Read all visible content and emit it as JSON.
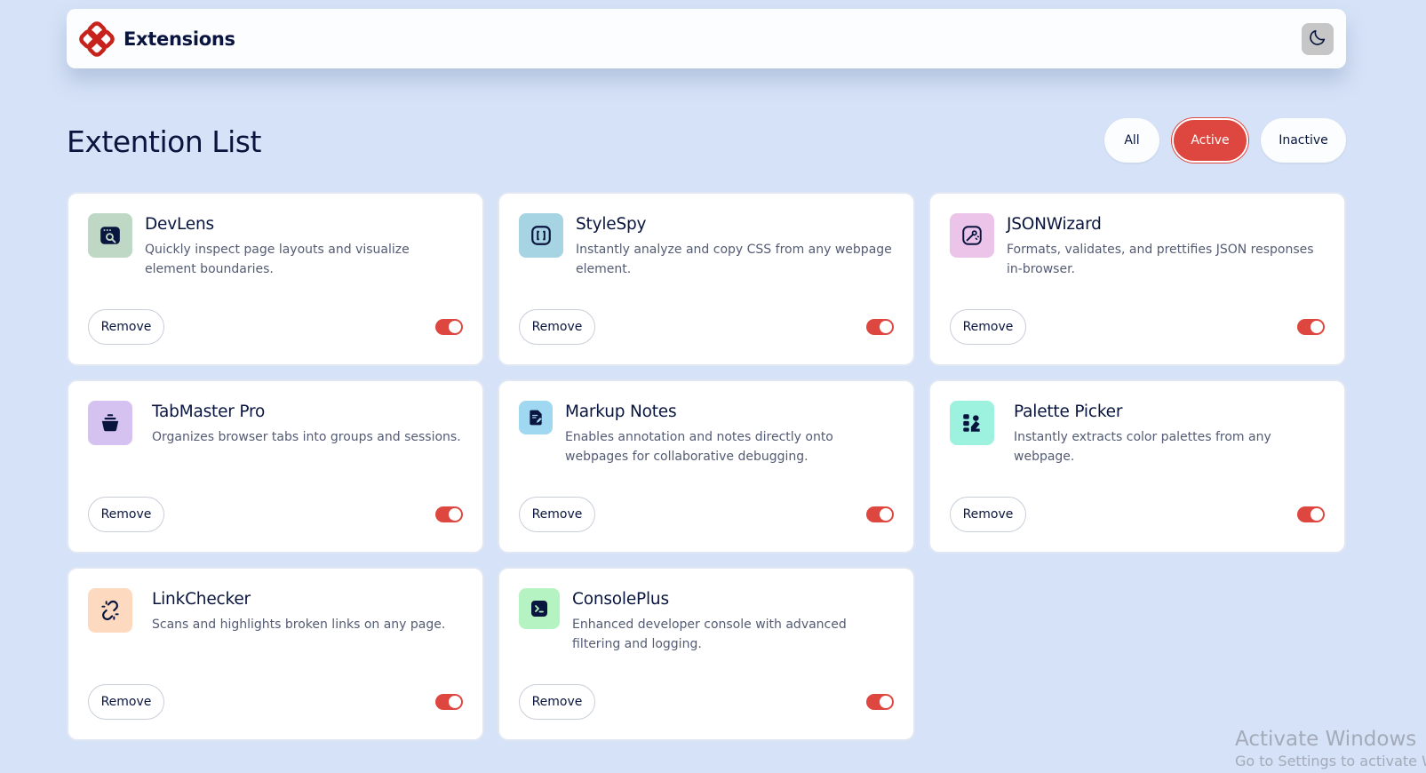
{
  "header": {
    "brand": "Extensions",
    "logo_icon": "extensions-logo-icon",
    "theme_toggle_icon": "moon-icon",
    "accent_color": "#de473f"
  },
  "main": {
    "title": "Extention List",
    "filters": [
      "All",
      "Active",
      "Inactive"
    ],
    "selected_filter": "Active",
    "remove_label": "Remove"
  },
  "extensions": [
    {
      "name": "DevLens",
      "description": "Quickly inspect page layouts and visualize element boundaries.",
      "icon": "devlens-icon",
      "icon_bg": "#bfd8c6",
      "enabled": true
    },
    {
      "name": "StyleSpy",
      "description": "Instantly analyze and copy CSS from any webpage element.",
      "icon": "stylespy-icon",
      "icon_bg": "#a6d4e3",
      "enabled": true
    },
    {
      "name": "JSONWizard",
      "description": "Formats, validates, and prettifies JSON responses in-browser.",
      "icon": "jsonwizard-icon",
      "icon_bg": "#ecc4e9",
      "enabled": true
    },
    {
      "name": "TabMaster Pro",
      "description": "Organizes browser tabs into groups and sessions.",
      "icon": "tabmaster-icon",
      "icon_bg": "#d6c2f0",
      "enabled": true
    },
    {
      "name": "Markup Notes",
      "description": "Enables annotation and notes directly onto webpages for collaborative debugging.",
      "icon": "markup-notes-icon",
      "icon_bg": "#9fd8f0",
      "enabled": true
    },
    {
      "name": "Palette Picker",
      "description": "Instantly extracts color palettes from any webpage.",
      "icon": "palette-picker-icon",
      "icon_bg": "#9df1df",
      "enabled": true
    },
    {
      "name": "LinkChecker",
      "description": "Scans and highlights broken links on any page.",
      "icon": "link-checker-icon",
      "icon_bg": "#fdd9c0",
      "enabled": true
    },
    {
      "name": "ConsolePlus",
      "description": "Enhanced developer console with advanced filtering and logging.",
      "icon": "console-plus-icon",
      "icon_bg": "#b6f3c3",
      "enabled": true
    }
  ],
  "watermark": {
    "line1": "Activate Windows",
    "line2": "Go to Settings to activate W"
  }
}
